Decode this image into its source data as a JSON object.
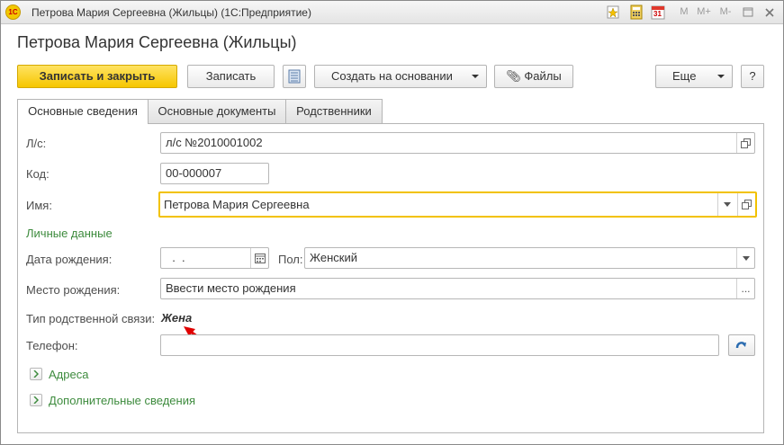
{
  "window": {
    "title": "Петрова Мария Сергеевна (Жильцы) (1С:Предприятие)",
    "app_logo_text": "1С",
    "toolbar_m": "M",
    "toolbar_mplus": "M+",
    "toolbar_mminus": "M-",
    "calendar_day": "31"
  },
  "header": {
    "page_title": "Петрова Мария Сергеевна (Жильцы)"
  },
  "toolbar": {
    "save_close_label": "Записать и закрыть",
    "save_label": "Записать",
    "create_based_label": "Создать на основании",
    "files_label": "Файлы",
    "more_label": "Еще",
    "help_label": "?"
  },
  "tabs": [
    {
      "label": "Основные сведения"
    },
    {
      "label": "Основные документы"
    },
    {
      "label": "Родственники"
    }
  ],
  "form": {
    "account_label": "Л/с:",
    "account_value": "л/с №2010001002",
    "code_label": "Код:",
    "code_value": "00-000007",
    "name_label": "Имя:",
    "name_value": "Петрова Мария Сергеевна",
    "personal_data_header": "Личные данные",
    "birthdate_label": "Дата рождения:",
    "birthdate_value": "  .  .",
    "gender_label": "Пол:",
    "gender_value": "Женский",
    "birthplace_label": "Место рождения:",
    "birthplace_placeholder": "Ввести место рождения",
    "relation_label": "Тип родственной связи:",
    "relation_value": "Жена",
    "phone_label": "Телефон:",
    "phone_value": "",
    "addresses_label": "Адреса",
    "additional_label": "Дополнительные сведения"
  },
  "colors": {
    "primary_button": "#f6c600",
    "group_header": "#3d8b3d",
    "annotation_arrow": "#e00000",
    "focus_border": "#f2c200"
  }
}
